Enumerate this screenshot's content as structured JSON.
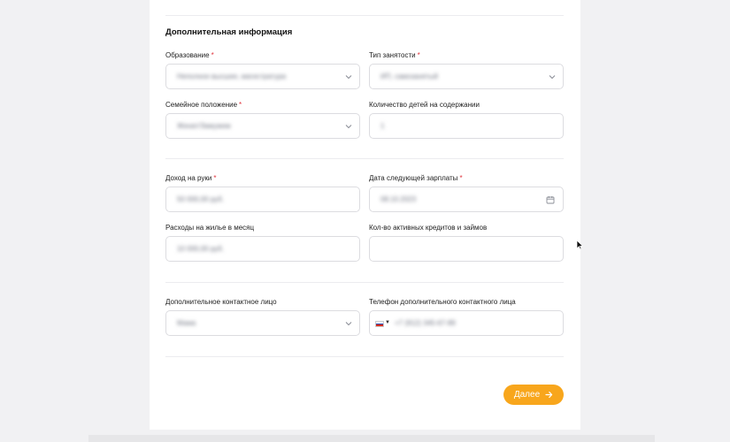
{
  "section": {
    "title": "Дополнительная информация"
  },
  "fields": {
    "education": {
      "label": "Образование",
      "required": "*",
      "value": "Неполное высшее, магистратура"
    },
    "employment": {
      "label": "Тип занятости",
      "required": "*",
      "value": "ИП, самозанятый"
    },
    "marital": {
      "label": "Семейное положение",
      "required": "*",
      "value": "Женат/Замужем"
    },
    "children": {
      "label": "Количество детей на содержании",
      "value": "1"
    },
    "income": {
      "label": "Доход на руки",
      "required": "*",
      "value": "50 000,00 руб."
    },
    "next_salary": {
      "label": "Дата следующей зарплаты",
      "required": "*",
      "value": "08.10.2023"
    },
    "housing": {
      "label": "Расходы на жилье в месяц",
      "value": "10 000,00 руб."
    },
    "credits": {
      "label": "Кол-во активных кредитов и займов",
      "value": ""
    },
    "contact_person": {
      "label": "Дополнительное контактное лицо",
      "value": "Мама"
    },
    "contact_phone": {
      "label": "Телефон дополнительного контактного лица",
      "value": "+7 (912) 345-67-89"
    }
  },
  "actions": {
    "next_label": "Далее",
    "next_icon": "arrow-right-icon"
  },
  "colors": {
    "accent": "#f8a61c",
    "required": "#e0323b",
    "border": "#dcdce0",
    "background": "#f1f1f3"
  }
}
